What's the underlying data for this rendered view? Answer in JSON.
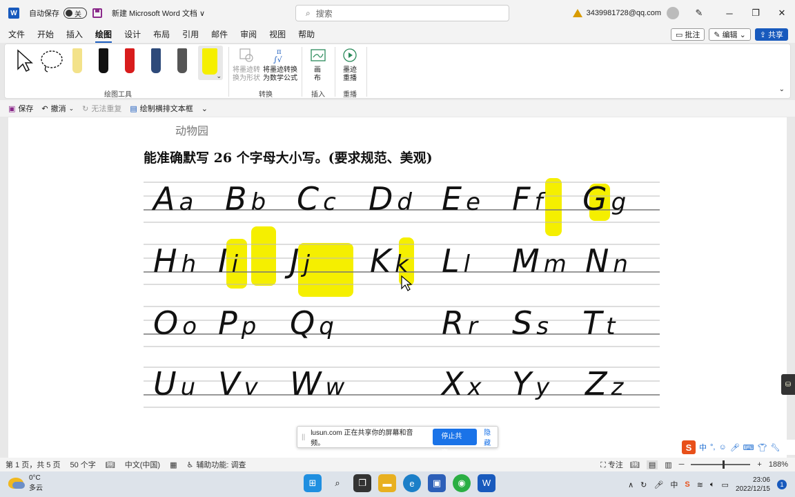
{
  "titlebar": {
    "app_logo": "W",
    "autosave_label": "自动保存",
    "autosave_state": "关",
    "document_title": "新建 Microsoft Word 文档",
    "title_chevron": "∨",
    "search_placeholder": "搜索",
    "account": "3439981728@qq.com"
  },
  "menu": {
    "tabs": [
      "文件",
      "开始",
      "插入",
      "绘图",
      "设计",
      "布局",
      "引用",
      "邮件",
      "审阅",
      "视图",
      "帮助"
    ],
    "active_tab": "绘图",
    "comments": "批注",
    "editing": "编辑",
    "share": "共享"
  },
  "ribbon": {
    "group_draw": "绘图工具",
    "group_convert": "转换",
    "group_insert": "插入",
    "group_replay": "重播",
    "convert_shape": [
      "将墨迹转",
      "换为形状"
    ],
    "convert_math": [
      "将墨迹转换",
      "为数学公式"
    ],
    "canvas": [
      "画",
      "布"
    ],
    "replay": [
      "墨迹",
      "重播"
    ],
    "pens": [
      {
        "name": "pencil-tool",
        "color": "#f3e28a"
      },
      {
        "name": "black-pen",
        "color": "#111111"
      },
      {
        "name": "red-pen",
        "color": "#d81c1c"
      },
      {
        "name": "galaxy-pen",
        "color": "#2e4a7a"
      },
      {
        "name": "silver-pen",
        "color": "#555555"
      },
      {
        "name": "yellow-highlighter",
        "color": "#f5ef00"
      }
    ]
  },
  "qat": {
    "save": "保存",
    "undo": "撤消",
    "redo": "无法重复",
    "draw_textbox": "绘制横排文本框"
  },
  "document": {
    "faded_line": "动物园",
    "heading": "能准确默写 26 个字母大小写。(要求规范、美观)",
    "rows": [
      [
        "Aa",
        "Bb",
        "Cc",
        "Dd",
        "Ee",
        "Ff",
        "Gg"
      ],
      [
        "Hh",
        "Ii",
        "Jj",
        "Kk",
        "Ll",
        "Mm",
        "Nn"
      ],
      [
        "Oo",
        "Pp",
        "Qq",
        "Rr",
        "Ss",
        "Tt"
      ],
      [
        "Uu",
        "Vv",
        "Ww",
        "Xx",
        "Yy",
        "Zz"
      ]
    ],
    "highlight_color": "#f5ef00"
  },
  "share_notice": {
    "text": "lusun.com 正在共享你的屏幕和音频。",
    "stop": "停止共享",
    "hide": "隐藏"
  },
  "ime": {
    "logo": "S",
    "mode": "中"
  },
  "status": {
    "page": "第 1 页，共 5 页",
    "words": "50 个字",
    "language": "中文(中国)",
    "accessibility": "辅助功能: 调查",
    "focus": "专注",
    "zoom": "188%"
  },
  "taskbar": {
    "temperature": "0°C",
    "weather": "多云",
    "time": "23:06",
    "date": "2022/12/15",
    "notifications": "1"
  }
}
